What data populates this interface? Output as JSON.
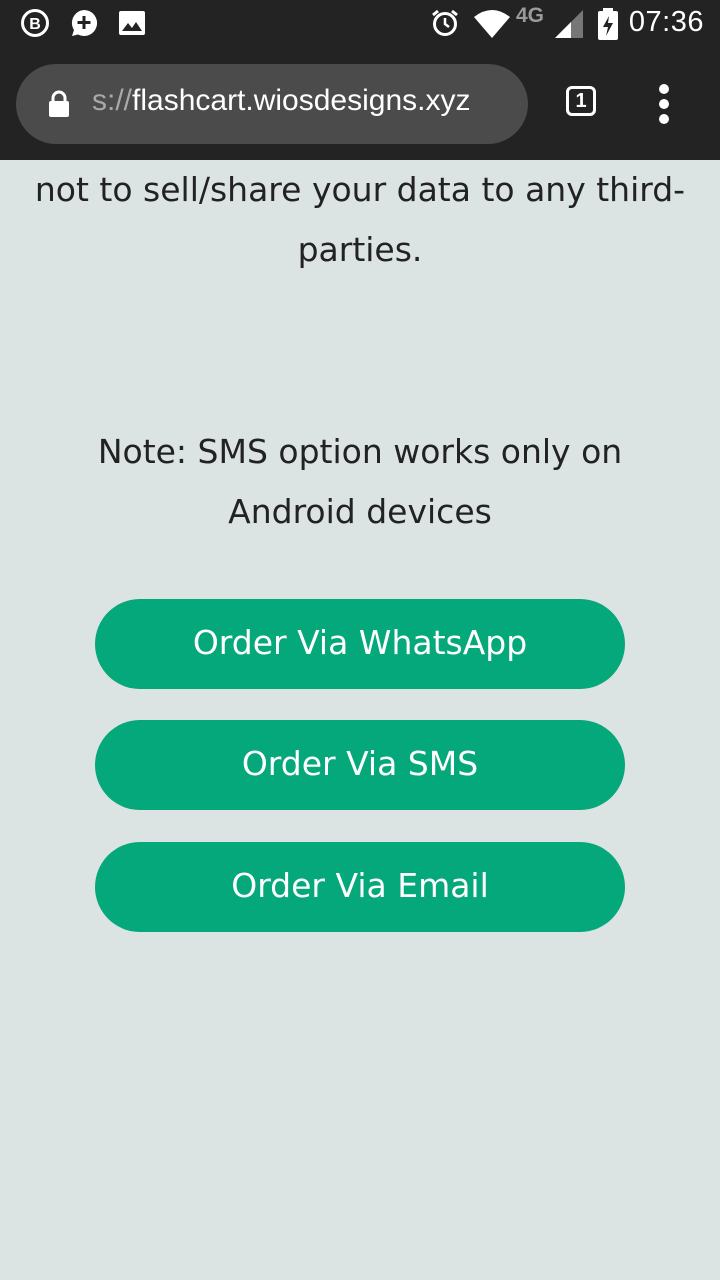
{
  "status_bar": {
    "time": "07:36",
    "network": "4G",
    "icons": [
      "business-b-icon",
      "chat-plus-icon",
      "image-icon",
      "alarm-icon",
      "wifi-icon",
      "signal-icon",
      "battery-charging-icon"
    ]
  },
  "browser": {
    "url_scheme": "s://",
    "url_host": "flashcart.wiosdesigns.xyz",
    "tab_count": "1"
  },
  "content": {
    "privacy_text": "will be shared with us, and we promise not to sell/share your data to any third-parties.",
    "note": "Note: SMS option works only on Android devices",
    "buttons": {
      "whatsapp": "Order Via WhatsApp",
      "sms": "Order Via SMS",
      "email": "Order Via Email"
    }
  },
  "colors": {
    "accent": "#05a87a",
    "background": "#dce4e3",
    "toolbar": "#222322"
  }
}
